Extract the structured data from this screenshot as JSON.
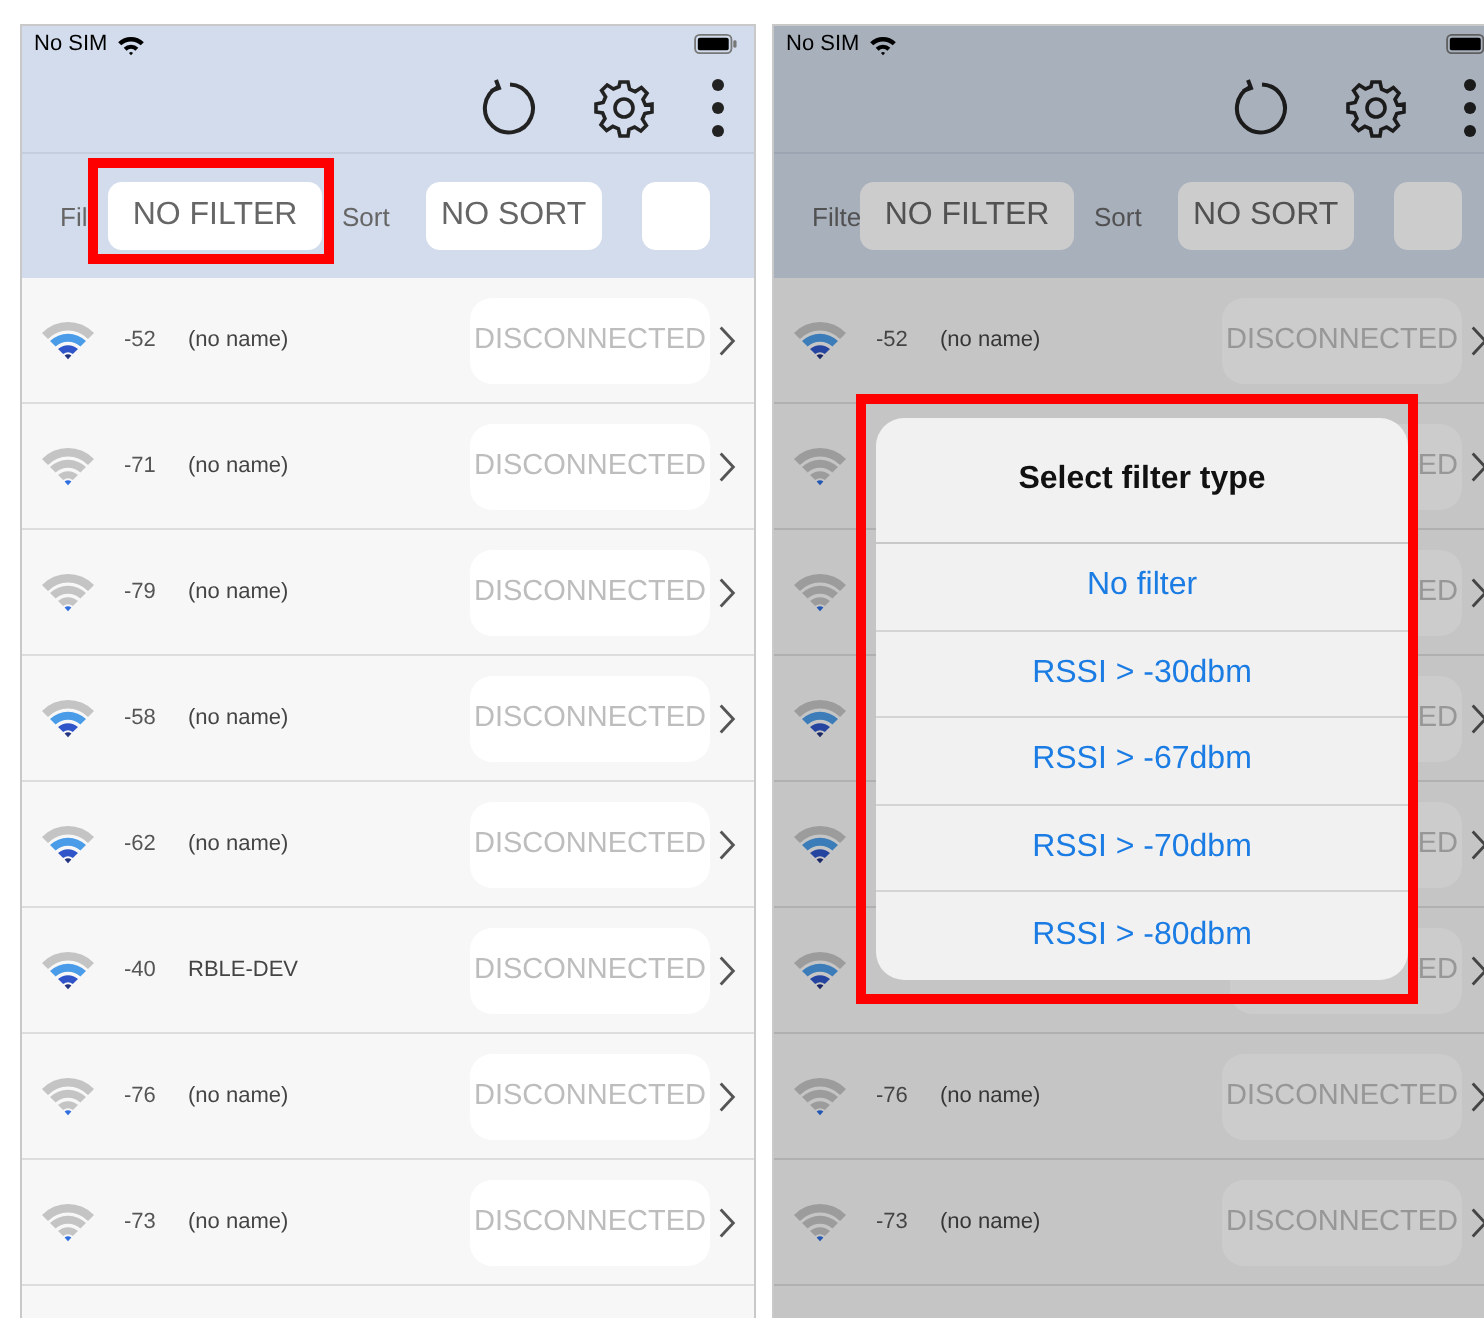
{
  "phones": [
    {
      "dimmed": false,
      "status_bar": {
        "carrier": "No SIM"
      },
      "filter_label": "Fil",
      "filter_button": {
        "label": "NO FILTER",
        "highlighted": true
      },
      "sort_label": "Sort",
      "sort_button": "NO SORT",
      "rows": [
        {
          "kind": "strong",
          "rssi": "-52",
          "name": "(no name)",
          "status": "DISCONNECTED"
        },
        {
          "kind": "weak",
          "rssi": "-71",
          "name": "(no name)",
          "status": "DISCONNECTED"
        },
        {
          "kind": "weak",
          "rssi": "-79",
          "name": "(no name)",
          "status": "DISCONNECTED"
        },
        {
          "kind": "strong",
          "rssi": "-58",
          "name": "(no name)",
          "status": "DISCONNECTED"
        },
        {
          "kind": "strong",
          "rssi": "-62",
          "name": "(no name)",
          "status": "DISCONNECTED"
        },
        {
          "kind": "strong",
          "rssi": "-40",
          "name": "RBLE-DEV",
          "status": "DISCONNECTED"
        },
        {
          "kind": "weak",
          "rssi": "-76",
          "name": "(no name)",
          "status": "DISCONNECTED"
        },
        {
          "kind": "weak",
          "rssi": "-73",
          "name": "(no name)",
          "status": "DISCONNECTED"
        }
      ]
    },
    {
      "dimmed": true,
      "status_bar": {
        "carrier": "No SIM"
      },
      "filter_label": "Filte",
      "filter_button": {
        "label": "NO FILTER",
        "highlighted": false
      },
      "sort_label": "Sort",
      "sort_button": "NO SORT",
      "rows": [
        {
          "kind": "strong",
          "rssi": "-52",
          "name": "(no name)",
          "status": "DISCONNECTED"
        },
        {
          "kind": "weak",
          "status": "ED"
        },
        {
          "kind": "weak",
          "status": "ED"
        },
        {
          "kind": "strong",
          "status": "ED"
        },
        {
          "kind": "strong",
          "status": "ED"
        },
        {
          "kind": "strong",
          "status": "ED"
        },
        {
          "kind": "weak",
          "rssi": "-76",
          "name": "(no name)",
          "status": "DISCONNECTED"
        },
        {
          "kind": "weak",
          "rssi": "-73",
          "name": "(no name)",
          "status": "DISCONNECTED"
        }
      ],
      "dialog": {
        "title": "Select filter type",
        "highlighted": true,
        "options": [
          "No filter",
          "RSSI > -30dbm",
          "RSSI > -67dbm",
          "RSSI > -70dbm",
          "RSSI > -80dbm"
        ]
      }
    }
  ]
}
